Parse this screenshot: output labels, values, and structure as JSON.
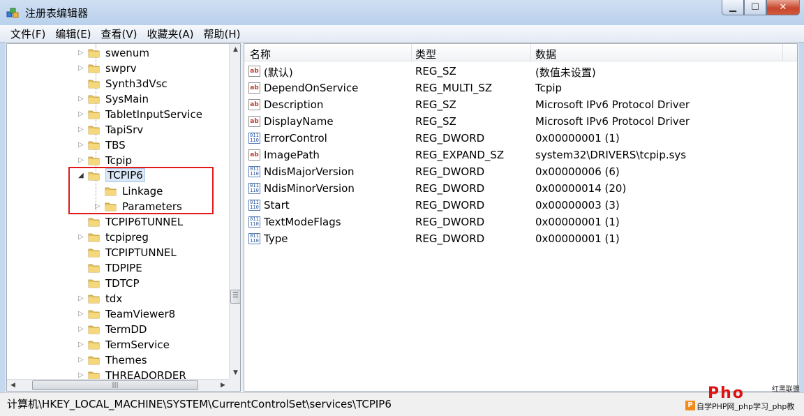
{
  "window": {
    "title": "注册表编辑器",
    "controls": {
      "minimize": "▁",
      "maximize": "☐",
      "close": "✕"
    }
  },
  "menubar": [
    "文件(F)",
    "编辑(E)",
    "查看(V)",
    "收藏夹(A)",
    "帮助(H)"
  ],
  "tree": {
    "items": [
      {
        "label": "swenum",
        "expander": "▷"
      },
      {
        "label": "swprv",
        "expander": "▷"
      },
      {
        "label": "Synth3dVsc",
        "expander": ""
      },
      {
        "label": "SysMain",
        "expander": "▷"
      },
      {
        "label": "TabletInputService",
        "expander": "▷"
      },
      {
        "label": "TapiSrv",
        "expander": "▷"
      },
      {
        "label": "TBS",
        "expander": "▷"
      },
      {
        "label": "Tcpip",
        "expander": "▷"
      },
      {
        "label": "TCPIP6",
        "expander": "◢",
        "selected": true
      },
      {
        "label": "Linkage",
        "expander": "",
        "child": true
      },
      {
        "label": "Parameters",
        "expander": "▷",
        "child": true
      },
      {
        "label": "TCPIP6TUNNEL",
        "expander": ""
      },
      {
        "label": "tcpipreg",
        "expander": "▷"
      },
      {
        "label": "TCPIPTUNNEL",
        "expander": ""
      },
      {
        "label": "TDPIPE",
        "expander": ""
      },
      {
        "label": "TDTCP",
        "expander": ""
      },
      {
        "label": "tdx",
        "expander": "▷"
      },
      {
        "label": "TeamViewer8",
        "expander": "▷"
      },
      {
        "label": "TermDD",
        "expander": "▷"
      },
      {
        "label": "TermService",
        "expander": "▷"
      },
      {
        "label": "Themes",
        "expander": "▷"
      },
      {
        "label": "THREADORDER",
        "expander": "▷"
      }
    ],
    "scroll": {
      "up": "▲",
      "down": "▼",
      "left": "◀",
      "right": "▶",
      "grip": "☰",
      "hgrip": "|||"
    }
  },
  "values": {
    "columns": [
      "名称",
      "类型",
      "数据"
    ],
    "rows": [
      {
        "icon": "string-value-icon",
        "name": "(默认)",
        "type": "REG_SZ",
        "data": "(数值未设置)"
      },
      {
        "icon": "string-value-icon",
        "name": "DependOnService",
        "type": "REG_MULTI_SZ",
        "data": "Tcpip"
      },
      {
        "icon": "string-value-icon",
        "name": "Description",
        "type": "REG_SZ",
        "data": "Microsoft IPv6 Protocol Driver"
      },
      {
        "icon": "string-value-icon",
        "name": "DisplayName",
        "type": "REG_SZ",
        "data": "Microsoft IPv6 Protocol Driver"
      },
      {
        "icon": "binary-value-icon",
        "name": "ErrorControl",
        "type": "REG_DWORD",
        "data": "0x00000001 (1)"
      },
      {
        "icon": "string-value-icon",
        "name": "ImagePath",
        "type": "REG_EXPAND_SZ",
        "data": "system32\\DRIVERS\\tcpip.sys"
      },
      {
        "icon": "binary-value-icon",
        "name": "NdisMajorVersion",
        "type": "REG_DWORD",
        "data": "0x00000006 (6)"
      },
      {
        "icon": "binary-value-icon",
        "name": "NdisMinorVersion",
        "type": "REG_DWORD",
        "data": "0x00000014 (20)"
      },
      {
        "icon": "binary-value-icon",
        "name": "Start",
        "type": "REG_DWORD",
        "data": "0x00000003 (3)"
      },
      {
        "icon": "binary-value-icon",
        "name": "TextModeFlags",
        "type": "REG_DWORD",
        "data": "0x00000001 (1)"
      },
      {
        "icon": "binary-value-icon",
        "name": "Type",
        "type": "REG_DWORD",
        "data": "0x00000001 (1)"
      }
    ],
    "icon_glyphs": {
      "sz": "ab",
      "dw": "011\n110"
    }
  },
  "statusbar": {
    "path": "计算机\\HKEY_LOCAL_MACHINE\\SYSTEM\\CurrentControlSet\\services\\TCPIP6"
  },
  "watermark": {
    "logo": "Pho",
    "brand": "红黑联盟",
    "p": "P",
    "text": "自学PHP网_php学习_php教"
  },
  "colors": {
    "highlight_box": "#e0191a",
    "folder": "#e8c35a",
    "selection": "#dbe8f7"
  }
}
